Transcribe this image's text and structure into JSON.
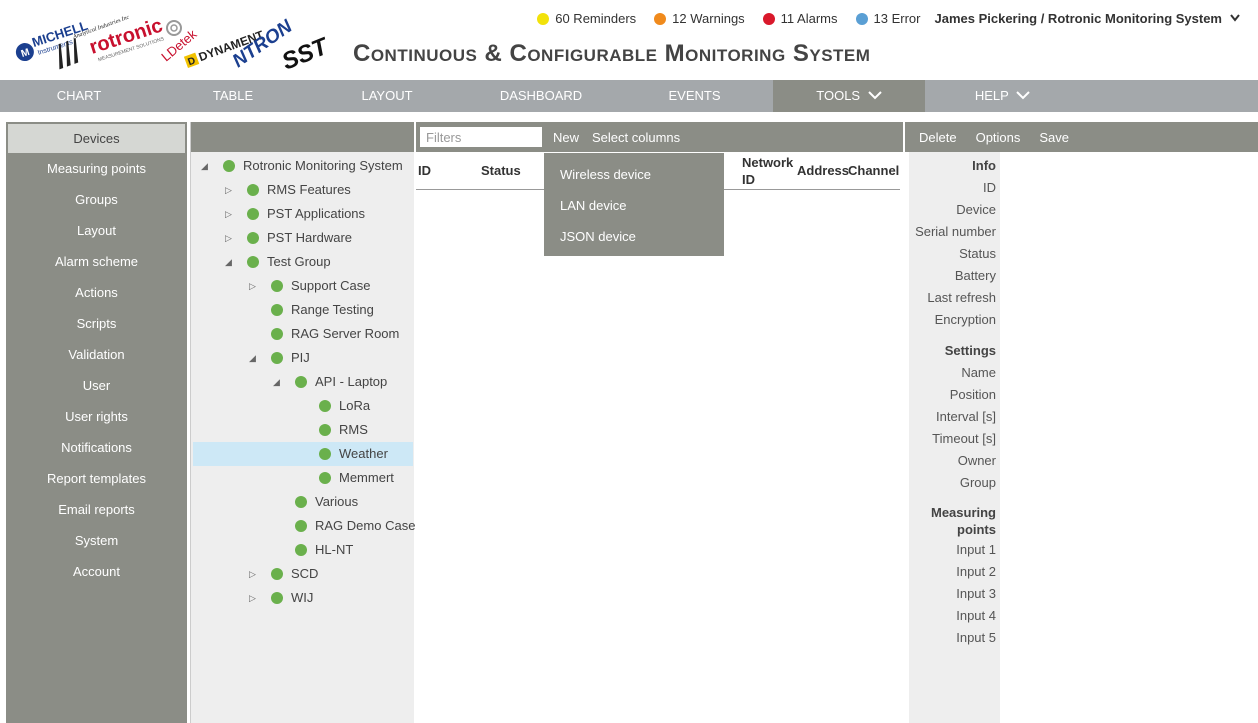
{
  "header": {
    "title": "Continuous & Configurable Monitoring System",
    "logos": {
      "michell": "MICHELL",
      "michell_sub": "Instruments",
      "analytical": "Analytical Industries Inc",
      "rotronic": "rotronic",
      "rotronic_sub": "MEASUREMENT SOLUTIONS",
      "ldetek": "LDetek",
      "dynament": "DYNAMENT",
      "ntron": "NTRON",
      "sst": "SST"
    },
    "status": [
      {
        "label": "60 Reminders",
        "color": "#f2e20a"
      },
      {
        "label": "12 Warnings",
        "color": "#f08a1c"
      },
      {
        "label": "11 Alarms",
        "color": "#d9182b"
      },
      {
        "label": "13 Error",
        "color": "#5a9fd4"
      }
    ],
    "user": "James Pickering / Rotronic Monitoring System"
  },
  "nav": {
    "items": [
      "CHART",
      "TABLE",
      "LAYOUT",
      "DASHBOARD",
      "EVENTS",
      "TOOLS",
      "HELP"
    ],
    "active": "TOOLS"
  },
  "sidebar": {
    "items": [
      "Devices",
      "Measuring points",
      "Groups",
      "Layout",
      "Alarm scheme",
      "Actions",
      "Scripts",
      "Validation",
      "User",
      "User rights",
      "Notifications",
      "Report templates",
      "Email reports",
      "System",
      "Account"
    ],
    "active": "Devices"
  },
  "tree": {
    "nodes": [
      {
        "label": "Rotronic Monitoring System",
        "level": 0,
        "toggle": "expanded"
      },
      {
        "label": "RMS Features",
        "level": 1,
        "toggle": "collapsed"
      },
      {
        "label": "PST Applications",
        "level": 1,
        "toggle": "collapsed"
      },
      {
        "label": "PST Hardware",
        "level": 1,
        "toggle": "collapsed"
      },
      {
        "label": "Test Group",
        "level": 1,
        "toggle": "expanded"
      },
      {
        "label": "Support Case",
        "level": 2,
        "toggle": "collapsed"
      },
      {
        "label": "Range Testing",
        "level": 2,
        "toggle": "none"
      },
      {
        "label": "RAG Server Room",
        "level": 2,
        "toggle": "none"
      },
      {
        "label": "PIJ",
        "level": 2,
        "toggle": "expanded"
      },
      {
        "label": "API - Laptop",
        "level": 3,
        "toggle": "expanded"
      },
      {
        "label": "LoRa",
        "level": 4,
        "toggle": "none"
      },
      {
        "label": "RMS",
        "level": 4,
        "toggle": "none"
      },
      {
        "label": "Weather",
        "level": 4,
        "toggle": "none"
      },
      {
        "label": "Memmert",
        "level": 4,
        "toggle": "none"
      },
      {
        "label": "Various",
        "level": 3,
        "toggle": "none"
      },
      {
        "label": "RAG Demo Case",
        "level": 3,
        "toggle": "none"
      },
      {
        "label": "HL-NT",
        "level": 3,
        "toggle": "none"
      },
      {
        "label": "SCD",
        "level": 2,
        "toggle": "collapsed"
      },
      {
        "label": "WIJ",
        "level": 2,
        "toggle": "collapsed"
      }
    ],
    "selected": "Weather"
  },
  "center": {
    "filter_placeholder": "Filters",
    "new_label": "New",
    "select_columns_label": "Select columns",
    "columns": {
      "id": "ID",
      "status": "Status",
      "network_id_1": "Network",
      "network_id_2": "ID",
      "address": "Address",
      "channel": "Channel"
    },
    "new_menu": [
      "Wireless device",
      "LAN device",
      "JSON device"
    ]
  },
  "right": {
    "toolbar": {
      "delete": "Delete",
      "options": "Options",
      "save": "Save"
    },
    "properties": {
      "info_head": "Info",
      "info": [
        "ID",
        "Device",
        "Serial number",
        "Status",
        "Battery",
        "Last refresh",
        "Encryption"
      ],
      "settings_head": "Settings",
      "settings": [
        "Name",
        "Position",
        "Interval [s]",
        "Timeout [s]",
        "Owner",
        "Group"
      ],
      "mp_head_1": "Measuring",
      "mp_head_2": "points",
      "measuring_points": [
        "Input 1",
        "Input 2",
        "Input 3",
        "Input 4",
        "Input 5"
      ]
    }
  }
}
